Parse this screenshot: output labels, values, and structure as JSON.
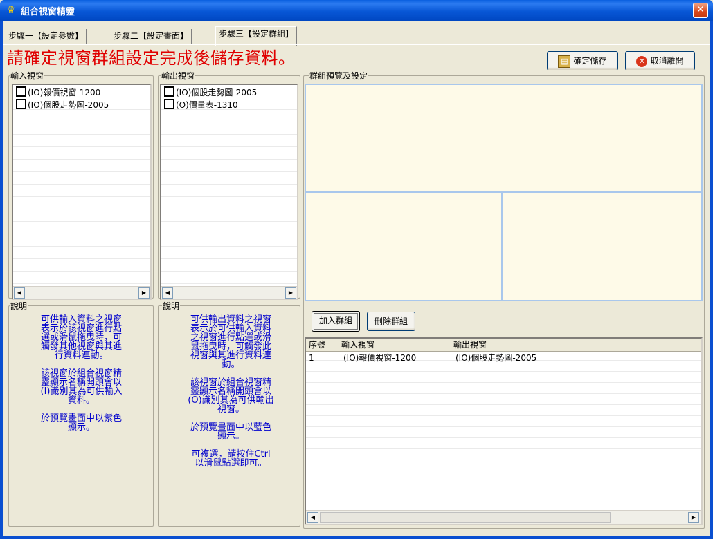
{
  "window": {
    "title": "組合視窗精靈",
    "close_glyph": "✕",
    "app_icon": "crown-icon"
  },
  "tabs": [
    {
      "label": "步驟一【設定參數】",
      "active": false
    },
    {
      "label": "步驟二【設定畫面】",
      "active": false
    },
    {
      "label": "步驟三【設定群組】",
      "active": true
    }
  ],
  "instruction": "請確定視窗群組設定完成後儲存資料。",
  "buttons": {
    "save": "確定儲存",
    "cancel": "取消離開",
    "add_group": "加入群組",
    "delete_group": "刪除群組"
  },
  "input_panel": {
    "title": "輸入視窗",
    "items": [
      "(IO)報價視窗-1200",
      "(IO)個股走勢圖-2005"
    ],
    "desc_title": "說明",
    "desc": "可供輸入資料之視窗\n表示於該視窗進行點\n選或滑鼠拖曳時，可\n觸發其他視窗與其進\n行資料連動。\n\n該視窗於組合視窗精\n靈顯示名稱開頭會以\n(I)識別其為可供輸入\n資料。\n\n於預覽畫面中以紫色\n顯示。"
  },
  "output_panel": {
    "title": "輸出視窗",
    "items": [
      "(IO)個股走勢圖-2005",
      "(O)價量表-1310"
    ],
    "desc_title": "說明",
    "desc": "可供輸出資料之視窗\n表示於可供輸入資料\n之視窗進行點選或滑\n鼠拖曳時，可觸發此\n視窗與其進行資料連\n動。\n\n該視窗於組合視窗精\n靈顯示名稱開頭會以\n(O)識別其為可供輸出\n視窗。\n\n於預覽畫面中以藍色\n顯示。\n\n可複選，請按住Ctrl\n以滑鼠點選即可。"
  },
  "preview": {
    "title": "群組預覽及設定"
  },
  "grid": {
    "headers": [
      "序號",
      "輸入視窗",
      "輸出視窗"
    ],
    "rows": [
      [
        "1",
        "(IO)報價視窗-1200",
        "(IO)個股走勢圖-2005"
      ]
    ]
  },
  "scroll": {
    "left": "◀",
    "right": "▶"
  },
  "colors": {
    "title_bar": "#0a5fe0",
    "instruction": "#e00000",
    "description": "#0000cc",
    "preview_fill": "#fefae8",
    "preview_border": "#a9c7ec"
  }
}
